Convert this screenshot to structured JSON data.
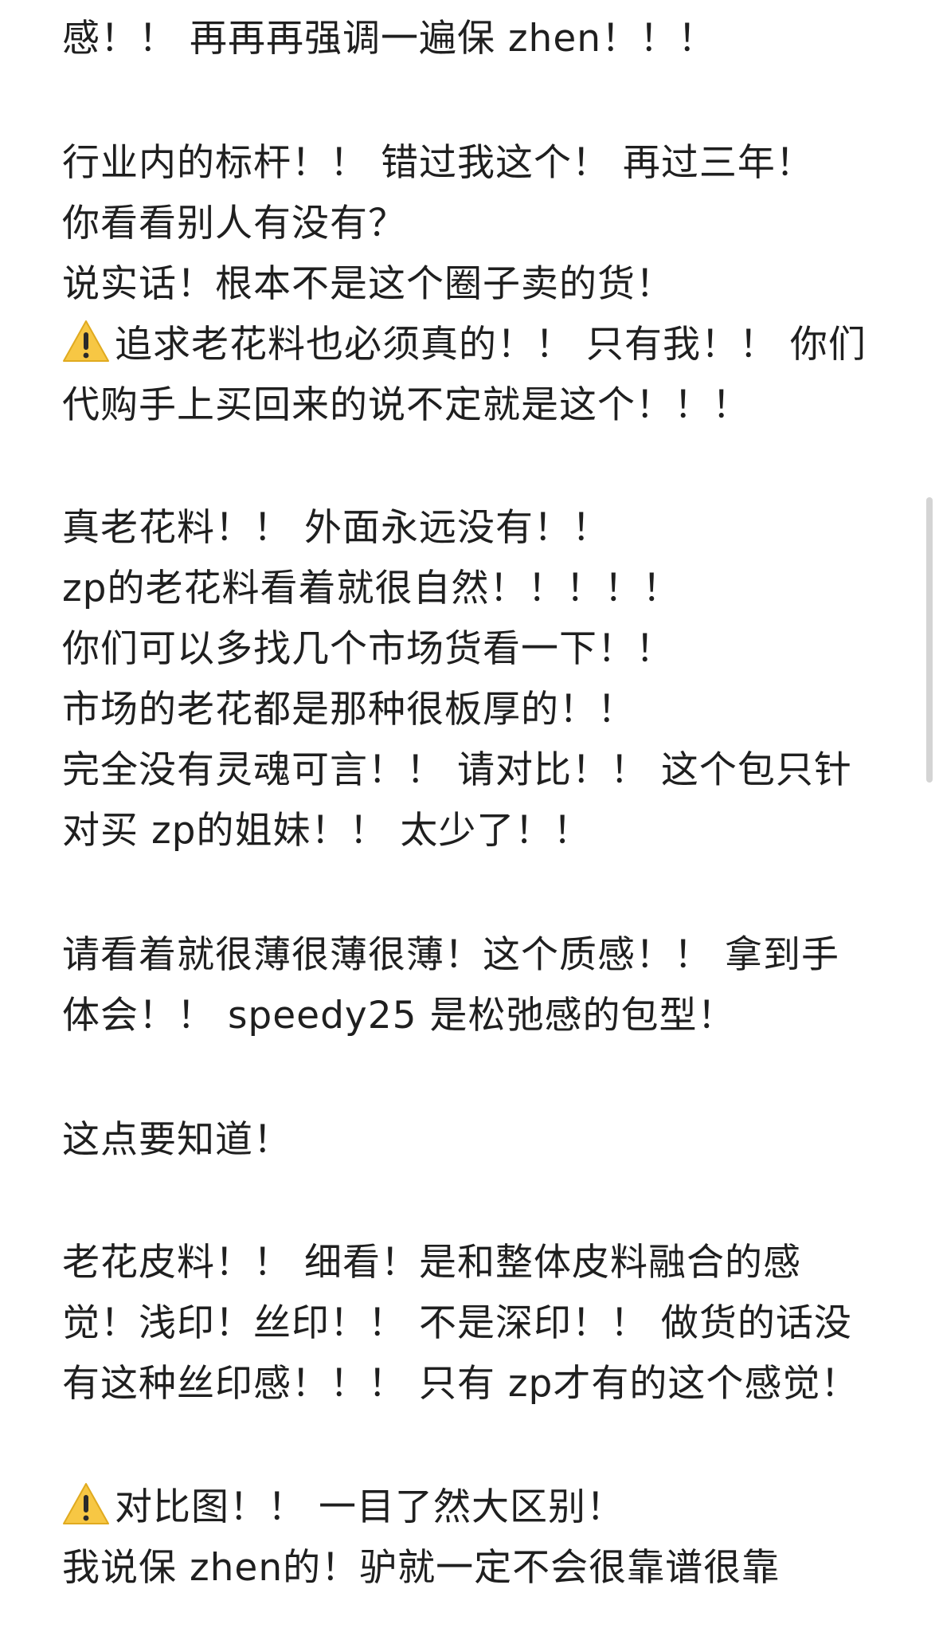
{
  "post": {
    "lines": [
      "感！！ 再再再强调一遍保 zhen！！！",
      "行业内的标杆！！ 错过我这个！ 再过三年！",
      "你看看别人有没有？",
      "说实话！根本不是这个圈子卖的货！",
      "追求老花料也必须真的！！ 只有我！！ 你们",
      "代购手上买回来的说不定就是这个！！！",
      "真老花料！！ 外面永远没有！！",
      "zp的老花料看着就很自然！！！！！",
      "你们可以多找几个市场货看一下！！",
      "市场的老花都是那种很板厚的！！",
      "完全没有灵魂可言！！ 请对比！！ 这个包只针",
      "对买 zp的姐妹！！ 太少了！！",
      "请看着就很薄很薄很薄！这个质感！！ 拿到手",
      "体会！！ speedy25 是松弛感的包型！",
      "这点要知道！",
      "老花皮料！！ 细看！是和整体皮料融合的感",
      "觉！浅印！丝印！！ 不是深印！！ 做货的话没",
      "有这种丝印感！！！ 只有 zp才有的这个感觉！",
      "对比图！！ 一目了然大区别！",
      "我说保 zhen的！驴就一定不会很靠谱很靠"
    ],
    "warning_icon": "warning-icon",
    "colors": {
      "text": "#1f1f1f",
      "warning_fill": "#f7c744",
      "warning_mark": "#2a2a2a",
      "scrollbar": "#d4d4d4"
    }
  }
}
